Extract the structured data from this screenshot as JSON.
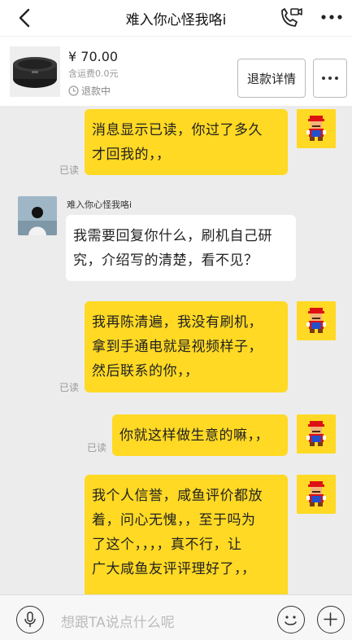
{
  "header": {
    "title": "难入你心怪我咯i"
  },
  "product": {
    "price": "¥ 70.00",
    "shipping": "含运费0.0元",
    "refund_status": "退款中",
    "refund_button": "退款详情"
  },
  "messages": [
    {
      "from": "me",
      "text_lines": [
        "消息显示已读，你过了多久",
        "才回我的，，"
      ],
      "read": "已读"
    },
    {
      "from": "other",
      "sender": "难入你心怪我咯i",
      "text_lines": [
        "我需要回复你什么，刷机自己研",
        "究，介绍写的清楚，看不见？"
      ]
    },
    {
      "from": "me",
      "text_lines": [
        "我再陈清遍，我没有刷机，",
        "拿到手通电就是视频样子，",
        "然后联系的你，，"
      ],
      "read": "已读"
    },
    {
      "from": "me",
      "text_lines": [
        "你就这样做生意的嘛，，"
      ],
      "read": "已读"
    },
    {
      "from": "me",
      "text_lines": [
        "我个人信誉，咸鱼评价都放",
        "着，问心无愧，，至于吗为",
        "了这个，，，，真不行，让",
        "广大咸鱼友评评理好了，，"
      ]
    }
  ],
  "input": {
    "placeholder": "想跟TA说点什么呢"
  },
  "colors": {
    "my_bubble": "#ffd924",
    "other_bubble": "#ffffff",
    "background": "#ececec"
  }
}
